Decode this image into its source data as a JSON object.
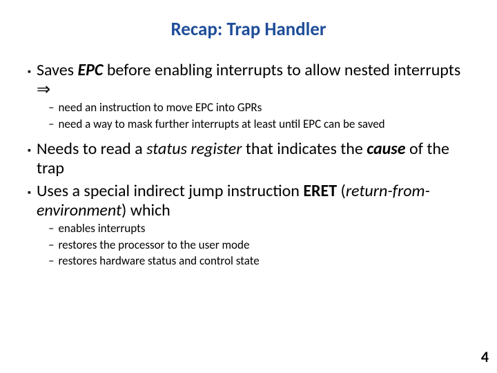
{
  "title": "Recap: Trap Handler",
  "bullets": {
    "b1_pre": "Saves ",
    "b1_epc": "EPC",
    "b1_mid": " before enabling interrupts to allow nested interrupts ",
    "b1_arrow": "⇒",
    "b1_s1": "need an instruction to move EPC into GPRs",
    "b1_s2": "need a way to mask further interrupts at least until EPC can be saved",
    "b2_pre": "Needs to read a ",
    "b2_sr": "status register",
    "b2_mid": " that indicates the ",
    "b2_cause": "cause",
    "b2_post": " of the trap",
    "b3_pre": "Uses a special indirect jump instruction ",
    "b3_eret": "ERET",
    "b3_mid1": " (",
    "b3_rfe": "return-from-environment",
    "b3_mid2": ") which",
    "b3_s1": "enables interrupts",
    "b3_s2": "restores the processor to the user mode",
    "b3_s3": "restores hardware status and control state"
  },
  "markers": {
    "square": "▪",
    "dash": "–"
  },
  "pagenum": "4"
}
